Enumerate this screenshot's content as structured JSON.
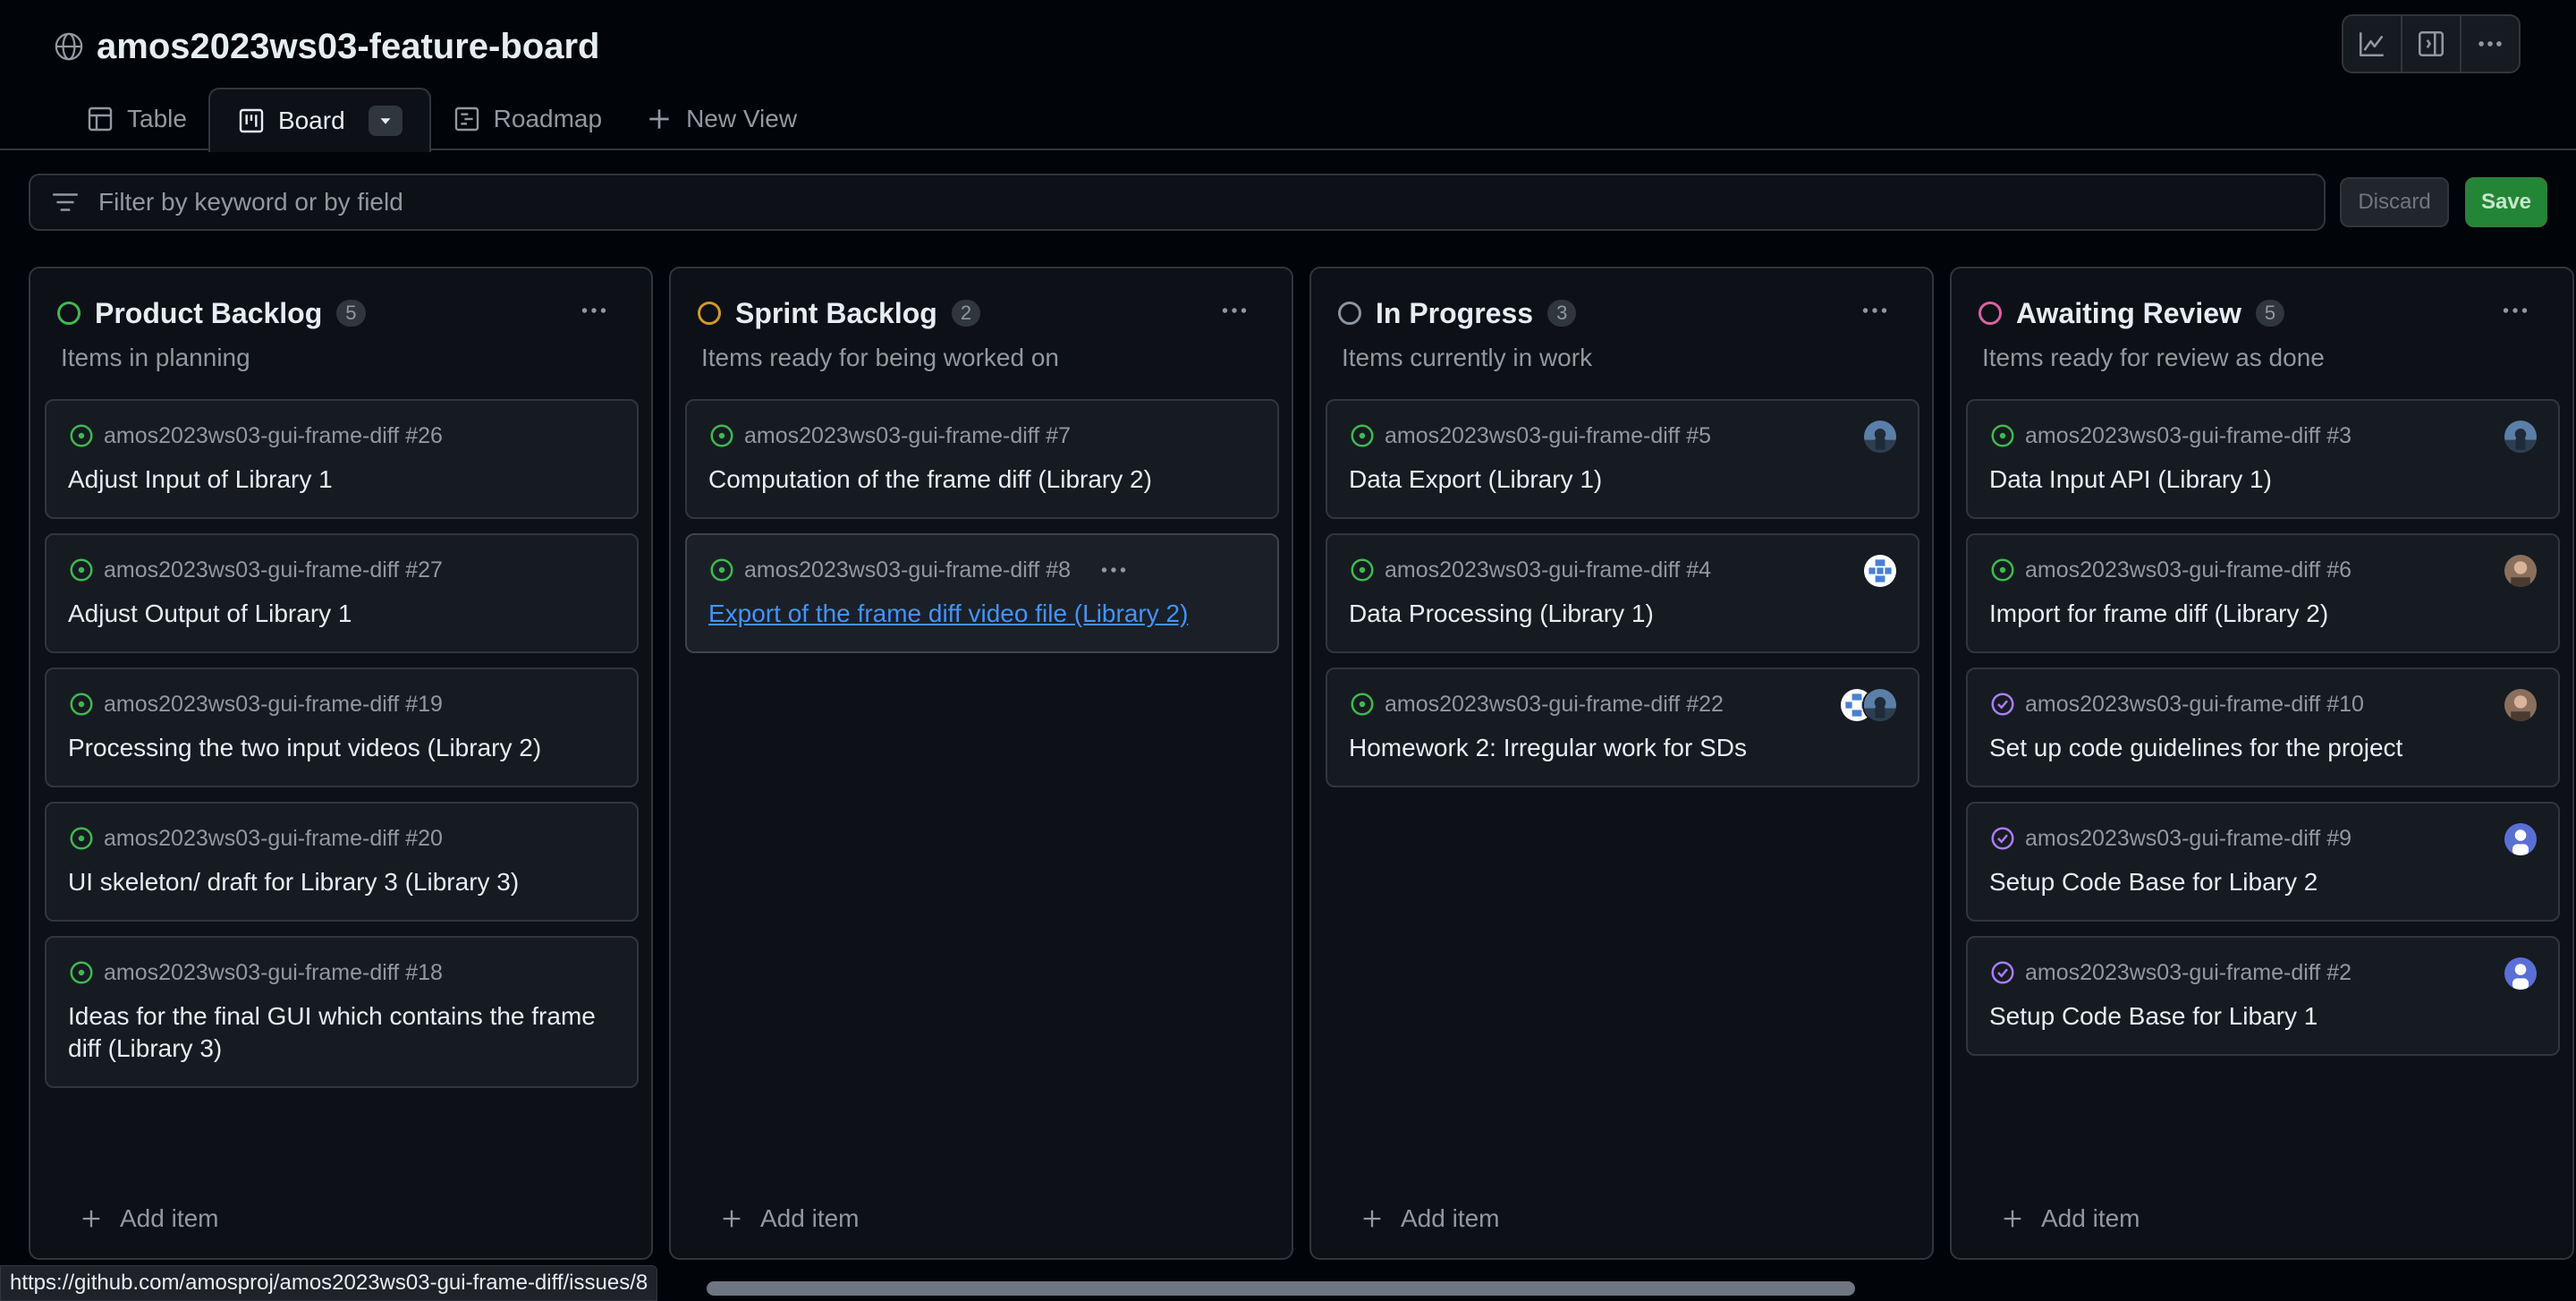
{
  "project": {
    "title": "amos2023ws03-feature-board"
  },
  "tabs": [
    {
      "label": "Table"
    },
    {
      "label": "Board"
    },
    {
      "label": "Roadmap"
    },
    {
      "label": "New View"
    }
  ],
  "filter": {
    "placeholder": "Filter by keyword or by field"
  },
  "actions": {
    "discard_label": "Discard",
    "save_label": "Save"
  },
  "colors": {
    "open_issue": "#3fb950",
    "closed_issue": "#ab7df8",
    "product_backlog": "#3fb950",
    "sprint_backlog": "#d29922",
    "in_progress": "#8b949e",
    "awaiting_review": "#db61a2",
    "link": "#4493f8"
  },
  "columns": [
    {
      "title": "Product Backlog",
      "count": "5",
      "description": "Items in planning",
      "add_label": "Add item",
      "cards": [
        {
          "repo": "amos2023ws03-gui-frame-diff #26",
          "title": "Adjust Input of Library 1"
        },
        {
          "repo": "amos2023ws03-gui-frame-diff #27",
          "title": "Adjust Output of Library 1"
        },
        {
          "repo": "amos2023ws03-gui-frame-diff #19",
          "title": "Processing the two input videos (Library 2)"
        },
        {
          "repo": "amos2023ws03-gui-frame-diff #20",
          "title": "UI skeleton/ draft for Library 3 (Library 3)"
        },
        {
          "repo": "amos2023ws03-gui-frame-diff #18",
          "title": "Ideas for the final GUI which contains the frame diff (Library 3)"
        }
      ]
    },
    {
      "title": "Sprint Backlog",
      "count": "2",
      "description": "Items ready for being worked on",
      "add_label": "Add item",
      "cards": [
        {
          "repo": "amos2023ws03-gui-frame-diff #7",
          "title": "Computation of the frame diff (Library 2)"
        },
        {
          "repo": "amos2023ws03-gui-frame-diff #8",
          "title": "Export of the frame diff video file (Library 2)"
        }
      ]
    },
    {
      "title": "In Progress",
      "count": "3",
      "description": "Items currently in work",
      "add_label": "Add item",
      "cards": [
        {
          "repo": "amos2023ws03-gui-frame-diff #5",
          "title": "Data Export (Library 1)"
        },
        {
          "repo": "amos2023ws03-gui-frame-diff #4",
          "title": "Data Processing (Library 1)"
        },
        {
          "repo": "amos2023ws03-gui-frame-diff #22",
          "title": "Homework 2: Irregular work for SDs"
        }
      ]
    },
    {
      "title": "Awaiting Review",
      "count": "5",
      "description": "Items ready for review as done",
      "add_label": "Add item",
      "cards": [
        {
          "repo": "amos2023ws03-gui-frame-diff #3",
          "title": "Data Input API (Library 1)"
        },
        {
          "repo": "amos2023ws03-gui-frame-diff #6",
          "title": "Import for frame diff (Library 2)"
        },
        {
          "repo": "amos2023ws03-gui-frame-diff #10",
          "title": "Set up code guidelines for the project"
        },
        {
          "repo": "amos2023ws03-gui-frame-diff #9",
          "title": "Setup Code Base for Libary 2"
        },
        {
          "repo": "amos2023ws03-gui-frame-diff #2",
          "title": "Setup Code Base for Libary 1"
        }
      ]
    }
  ],
  "status_bar": {
    "url": "https://github.com/amosproj/amos2023ws03-gui-frame-diff/issues/8"
  }
}
